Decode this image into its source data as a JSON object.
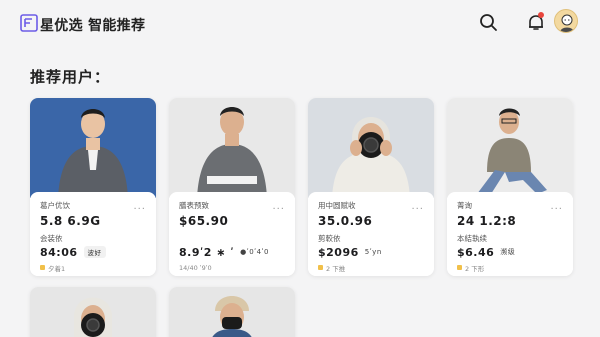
{
  "header": {
    "brand": "星优选 智能推荐",
    "icons": [
      "logo-icon",
      "search-icon",
      "bell-icon",
      "avatar"
    ]
  },
  "section_title": "推荐用户：",
  "cards": [
    {
      "label1": "葛户优饮",
      "value1": "5.8 6.9G",
      "label2": "会装依",
      "value2": "84:06",
      "tag": "波好",
      "foot": "夕着1",
      "more": "···"
    },
    {
      "label1": "膳表预致",
      "value1": "$65.90",
      "label2": "",
      "value2": "8.9ʹ2 ∗ ʹ",
      "sub": "●ʹ0ʹ4ʹ0",
      "foot": "14/40 ʹ9ʹ0",
      "more": "···"
    },
    {
      "label1": "用中圆赋收",
      "value1": "35.0.96",
      "label2": "剪較依",
      "value2": "$2096",
      "sub": "5ʹyn",
      "foot": "2 下推",
      "more": "···"
    },
    {
      "label1": "菁询",
      "value1": "24 1.2:8",
      "label2": "本結執续",
      "value2": "$6.46",
      "sub": "濒级",
      "foot": "2 下形",
      "more": "···"
    }
  ]
}
